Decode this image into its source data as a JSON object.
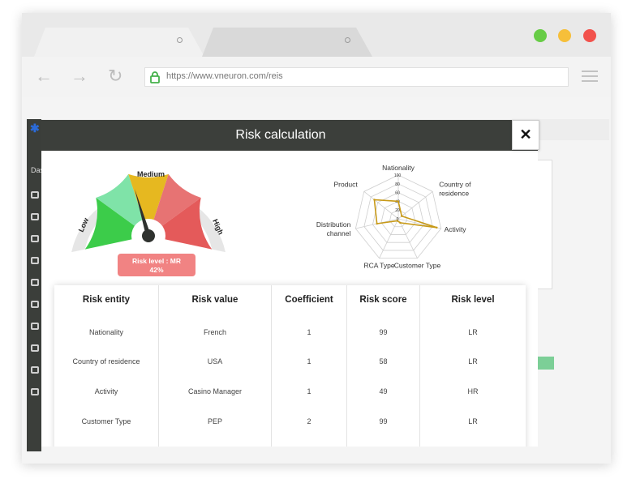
{
  "browser": {
    "url": "https://www.vneuron.com/reis",
    "window_buttons": {
      "green": "#67cc46",
      "yellow": "#f6bf3a",
      "red": "#f2524c"
    }
  },
  "app": {
    "sidebar_label": "Das"
  },
  "modal": {
    "title": "Risk calculation",
    "close_label": "✕",
    "gauge": {
      "labels": {
        "low": "Low",
        "medium": "Medium",
        "high": "High"
      },
      "value_percent": 42,
      "badge_line1": "Risk level : MR",
      "badge_line2": "42%"
    },
    "radar": {
      "axes": [
        "Nationality",
        "Country of residence",
        "Activity",
        "Customer Type",
        "RCA Type",
        "Distribution channel",
        "Product"
      ],
      "ticks": [
        "100",
        "80",
        "60",
        "40",
        "20",
        "0"
      ],
      "values": [
        40,
        10,
        90,
        10,
        5,
        50,
        70
      ],
      "color": "#c89a18"
    },
    "table": {
      "headers": [
        "Risk entity",
        "Risk value",
        "Coefficient",
        "Risk score",
        "Risk level"
      ],
      "rows": [
        [
          "Nationality",
          "French",
          "1",
          "99",
          "LR"
        ],
        [
          "Country of residence",
          "USA",
          "1",
          "58",
          "LR"
        ],
        [
          "Activity",
          "Casino Manager",
          "1",
          "49",
          "HR"
        ],
        [
          "Customer Type",
          "PEP",
          "2",
          "99",
          "LR"
        ]
      ]
    }
  }
}
